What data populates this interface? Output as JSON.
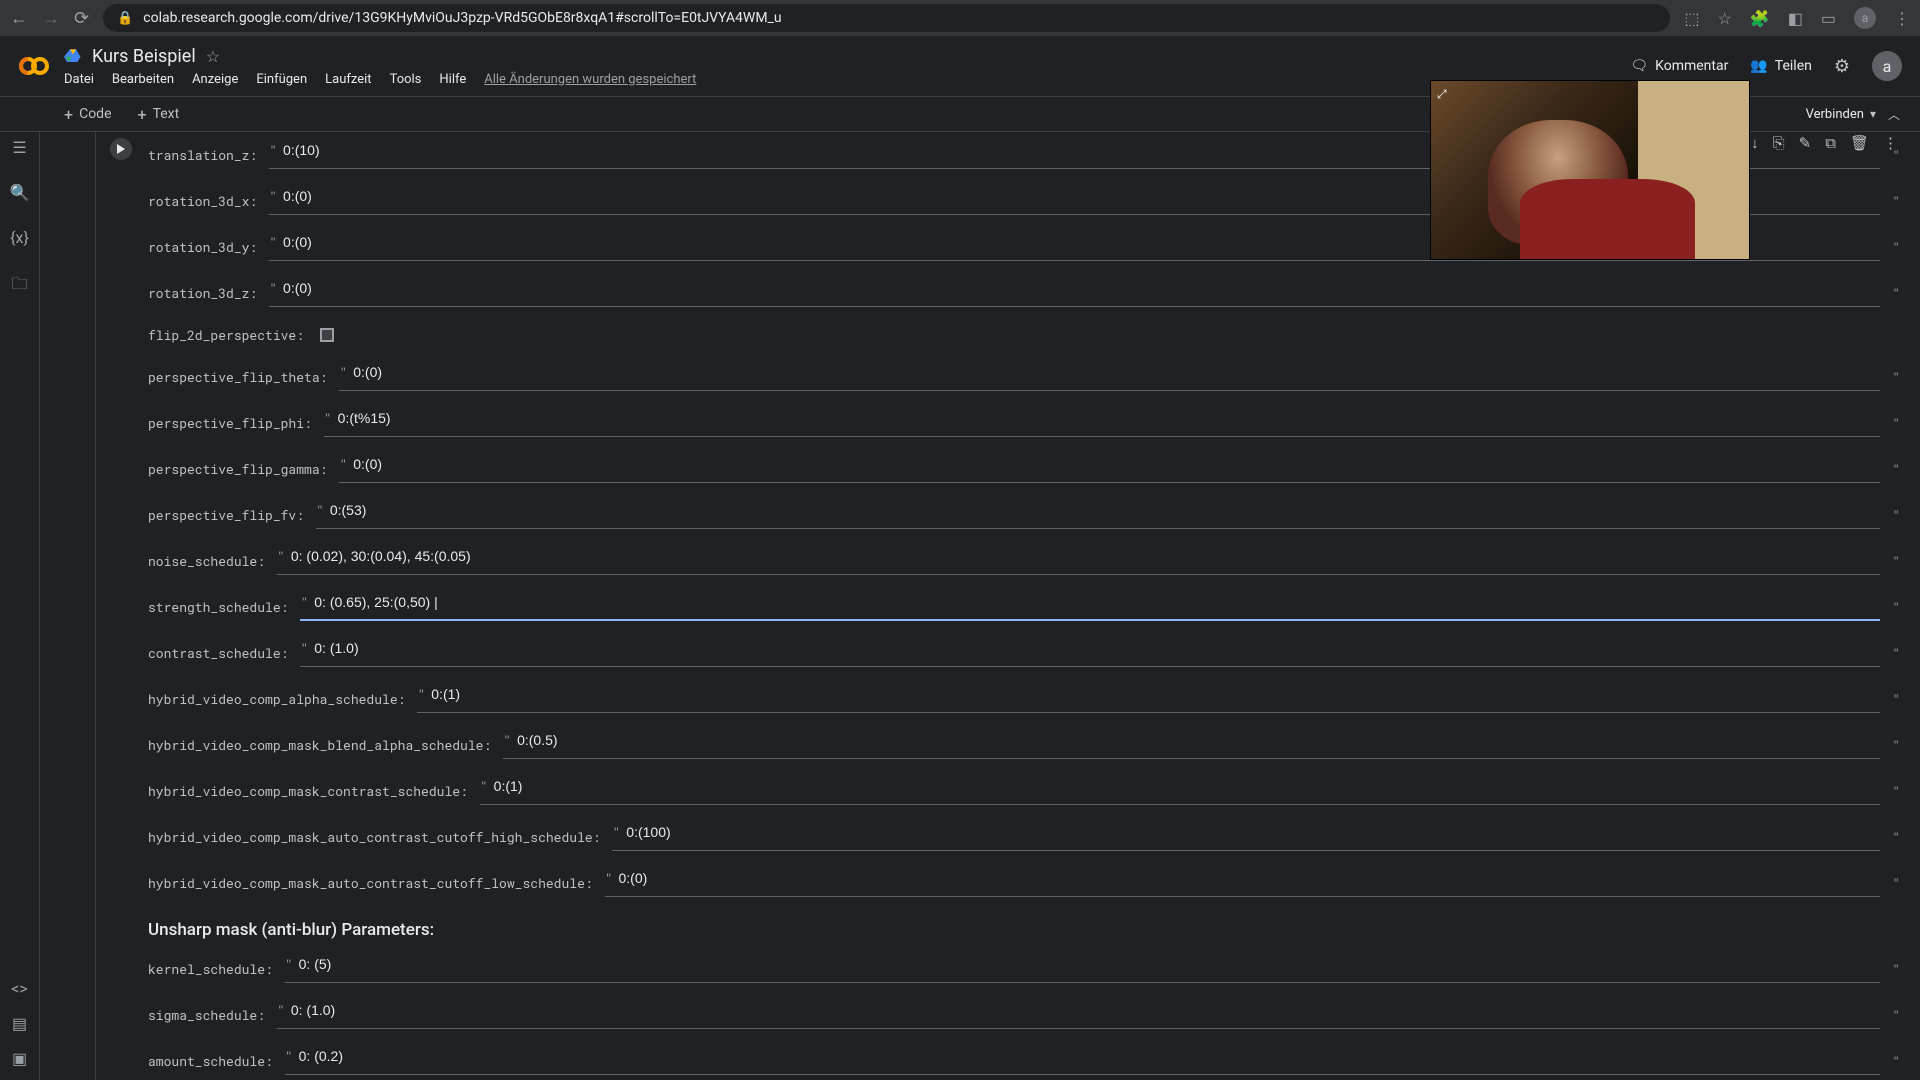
{
  "browser": {
    "url": "colab.research.google.com/drive/13G9KHyMviOuJ3pzp-VRd5GObE8r8xqA1#scrollTo=E0tJVYA4WM_u",
    "avatar": "a"
  },
  "header": {
    "title": "Kurs Beispiel",
    "menu": [
      "Datei",
      "Bearbeiten",
      "Anzeige",
      "Einfügen",
      "Laufzeit",
      "Tools",
      "Hilfe"
    ],
    "saved_message": "Alle Änderungen wurden gespeichert",
    "comment": "Kommentar",
    "share": "Teilen",
    "avatar": "a"
  },
  "toolbar": {
    "code": "Code",
    "text": "Text",
    "connect": "Verbinden"
  },
  "params": [
    {
      "label": "translation_z:",
      "value": "0:(10)"
    },
    {
      "label": "rotation_3d_x:",
      "value": "0:(0)"
    },
    {
      "label": "rotation_3d_y:",
      "value": "0:(0)"
    },
    {
      "label": "rotation_3d_z:",
      "value": "0:(0)"
    }
  ],
  "flip_2d_label": "flip_2d_perspective:",
  "params2": [
    {
      "label": "perspective_flip_theta:",
      "value": "0:(0)"
    },
    {
      "label": "perspective_flip_phi:",
      "value": "0:(t%15)"
    },
    {
      "label": "perspective_flip_gamma:",
      "value": "0:(0)"
    },
    {
      "label": "perspective_flip_fv:",
      "value": "0:(53)"
    },
    {
      "label": "noise_schedule:",
      "value": "0: (0.02), 30:(0.04), 45:(0.05)"
    },
    {
      "label": "strength_schedule:",
      "value": "0: (0.65), 25:(0,50) |",
      "active": true
    },
    {
      "label": "contrast_schedule:",
      "value": "0: (1.0)"
    },
    {
      "label": "hybrid_video_comp_alpha_schedule:",
      "value": "0:(1)"
    },
    {
      "label": "hybrid_video_comp_mask_blend_alpha_schedule:",
      "value": "0:(0.5)"
    },
    {
      "label": "hybrid_video_comp_mask_contrast_schedule:",
      "value": "0:(1)"
    },
    {
      "label": "hybrid_video_comp_mask_auto_contrast_cutoff_high_schedule:",
      "value": "0:(100)"
    },
    {
      "label": "hybrid_video_comp_mask_auto_contrast_cutoff_low_schedule:",
      "value": "0:(0)"
    }
  ],
  "section_title": "Unsharp mask (anti-blur) Parameters:",
  "params3": [
    {
      "label": "kernel_schedule:",
      "value": "0: (5)"
    },
    {
      "label": "sigma_schedule:",
      "value": "0: (1.0)"
    },
    {
      "label": "amount_schedule:",
      "value": "0: (0.2)"
    }
  ]
}
